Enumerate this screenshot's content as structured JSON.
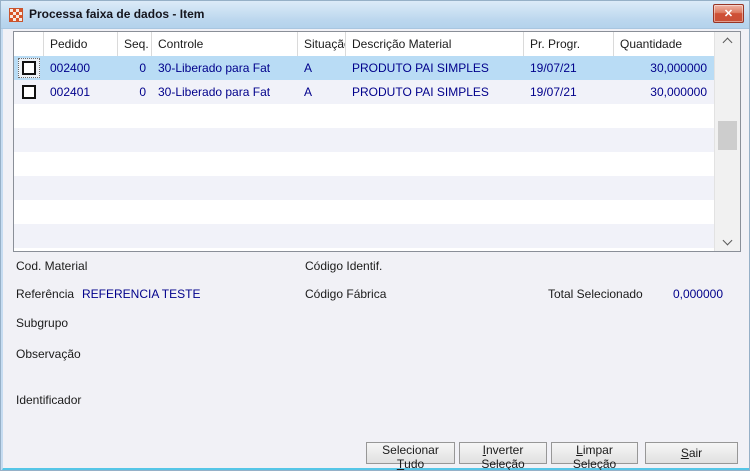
{
  "window": {
    "title": "Processa faixa de dados - Item",
    "close_glyph": "✕"
  },
  "grid": {
    "columns": [
      "",
      "Pedido",
      "Seq.",
      "Controle",
      "Situação",
      "Descrição Material",
      "Pr. Progr.",
      "Quantidade"
    ],
    "rows": [
      {
        "pedido": "002400",
        "seq": "0",
        "controle": "30-Liberado para Fat",
        "situacao": "A",
        "descricao": "PRODUTO PAI SIMPLES",
        "pr_progr": "19/07/21",
        "quantidade": "30,000000",
        "selected": true,
        "checked": false
      },
      {
        "pedido": "002401",
        "seq": "0",
        "controle": "30-Liberado para Fat",
        "situacao": "A",
        "descricao": "PRODUTO PAI SIMPLES",
        "pr_progr": "19/07/21",
        "quantidade": "30,000000",
        "selected": false,
        "checked": false
      }
    ]
  },
  "details": {
    "cod_material_label": "Cod. Material",
    "codigo_identif_label": "Código Identif.",
    "referencia_label": "Referência",
    "referencia_value": "REFERENCIA TESTE",
    "codigo_fabrica_label": "Código Fábrica",
    "total_selecionado_label": "Total Selecionado",
    "total_selecionado_value": "0,000000",
    "subgrupo_label": "Subgrupo",
    "observacao_label": "Observação",
    "identificador_label": "Identificador"
  },
  "buttons": {
    "select_all": {
      "pre": "Selecionar ",
      "mnemonic": "T",
      "post": "udo"
    },
    "invert": {
      "pre": "",
      "mnemonic": "I",
      "post": "nverter Seleção"
    },
    "clear": {
      "pre": "",
      "mnemonic": "L",
      "post": "impar Seleção"
    },
    "exit": {
      "pre": "",
      "mnemonic": "S",
      "post": "air"
    }
  },
  "colors": {
    "selected_row": "#b9dcf5",
    "alt_row": "#f1f2f9",
    "data_text": "#00008b",
    "titlebar": "#bcd7ee",
    "bottom_edge": "#55c6e7",
    "close_button": "#cf5136"
  }
}
